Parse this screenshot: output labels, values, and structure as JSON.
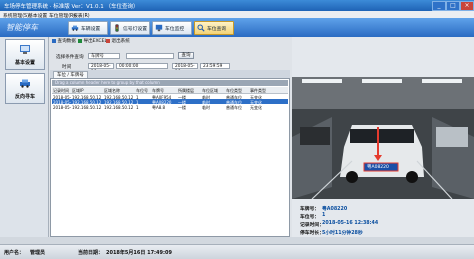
{
  "window": {
    "title": "车场停车管理系统 · 标准版    Ver：V1.0.1  （车位查询）",
    "btn_min": "_",
    "btn_max": "□",
    "btn_close": "×"
  },
  "menu": [
    "系统管理(S)",
    "基本设置",
    "车位管理(R)",
    "报表(R)"
  ],
  "brand": "智能停车",
  "nav": [
    {
      "label": "车辆设置"
    },
    {
      "label": "信号灯设置"
    },
    {
      "label": "车位监控"
    },
    {
      "label": "车位查询",
      "active": true
    }
  ],
  "sidebar": [
    {
      "label": "基本设置"
    },
    {
      "label": "反向寻车"
    }
  ],
  "toolbar": {
    "query_label": "查询数据",
    "export_label": "导出EXCEL",
    "exit_label": "退出系统"
  },
  "filter": {
    "condition_label": "选择条件查询",
    "condition_value": "车牌号",
    "keyword_value": "",
    "search_label": "查询",
    "time_label": "时间",
    "date_from": "2018-05-16",
    "time_from": "00:00:00",
    "date_to": "2018-05-16",
    "time_to": "23:59:59"
  },
  "tab": "车位 / 车牌号",
  "grid": {
    "group_hint": "Drag a column header here to group by that column",
    "columns": [
      "记录时间",
      "区域IP",
      "区域名称",
      "车位号",
      "车牌号",
      "所属楼层",
      "车位区域",
      "车位类型",
      "事件类型"
    ],
    "rows": [
      [
        "2018-05-16",
        "192.168.50.12",
        "192.168.50.12",
        "1",
        "粤A0F954",
        "一楼",
        "临时",
        "普通车位",
        "无变化"
      ],
      [
        "2018-05-16",
        "192.168.50.12",
        "192.168.50.12",
        "1",
        "粤A08220",
        "一楼",
        "临时",
        "普通车位",
        "无变化"
      ],
      [
        "2018-05-16",
        "192.168.50.12",
        "192.168.50.12",
        "1",
        "粤A8.8",
        "一楼",
        "临时",
        "普通车位",
        "无变化"
      ]
    ],
    "selected_row": 1
  },
  "detail": {
    "plate_label": "车牌号：",
    "plate_value": "粤A08220",
    "slot_label": "车位号：",
    "slot_value": "1",
    "time_label": "记录时间：",
    "time_value": "2018-05-16 12:38:44",
    "duration_label": "停车时长：",
    "duration_value": "5小时11分钟28秒",
    "photo_plate": "粤A08220"
  },
  "status": {
    "user_label": "用户名：",
    "user_value": "管理员",
    "date_label": "当前日期：",
    "date_value": "2018年5月16日 17:49:09"
  }
}
